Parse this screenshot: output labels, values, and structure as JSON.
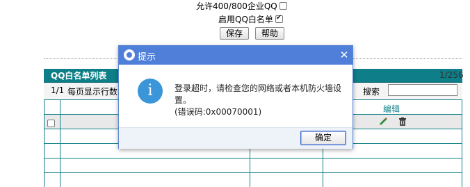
{
  "options": {
    "allow_400_label": "允许400/800企业QQ",
    "allow_400_checked": false,
    "whitelist_label": "启用QQ白名单",
    "whitelist_checked": true
  },
  "buttons": {
    "save": "保存",
    "help": "帮助"
  },
  "table": {
    "title": "QQ白名单列表",
    "count": "1/256",
    "page_info": "1/1",
    "per_page_label": "每页显示行数",
    "search_label": "搜索",
    "search_value": "",
    "edit_header": "编辑"
  },
  "dialog": {
    "title": "提示",
    "close_glyph": "✕",
    "message_line1": "登录超时，请检查您的网络或者本机防火墙设",
    "message_line2": "置。",
    "error_code": "(错误码:0x00070001)",
    "ok_label": "确定"
  },
  "colors": {
    "table_accent": "#0e7f88",
    "dialog_title_bg": "#4f7fd8",
    "info_icon": "#3a95d9"
  },
  "icons": {
    "edit": "pencil-icon",
    "delete": "trash-icon",
    "info": "info-icon",
    "logo": "app-logo-icon"
  }
}
